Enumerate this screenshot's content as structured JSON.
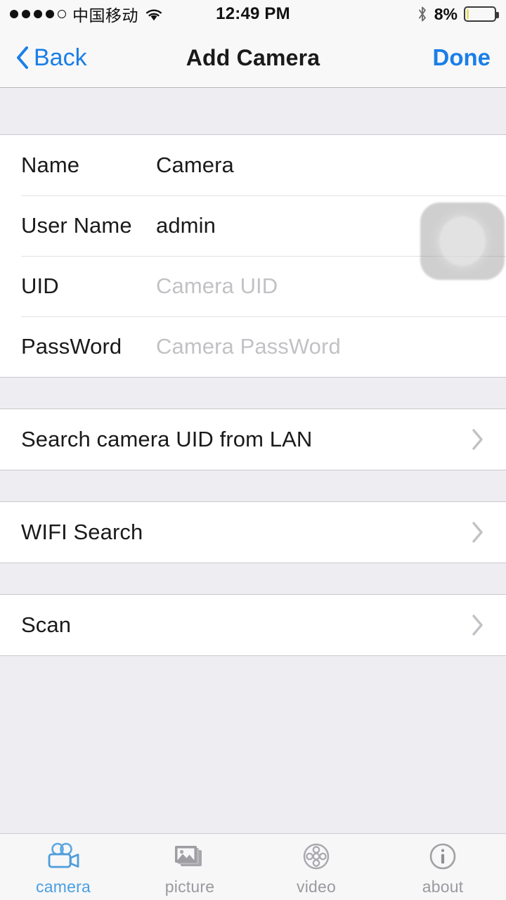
{
  "status_bar": {
    "signal_dots_filled": 4,
    "signal_dots_total": 5,
    "carrier": "中国移动",
    "wifi_icon": "wifi-icon",
    "time": "12:49 PM",
    "bluetooth_icon": "bluetooth-icon",
    "battery_percent": "8%",
    "battery_level": 8,
    "battery_color": "#e8dd6a"
  },
  "nav_bar": {
    "back_label": "Back",
    "back_icon": "chevron-left-icon",
    "title": "Add Camera",
    "done_label": "Done",
    "accent_color": "#1a7ee8"
  },
  "form": {
    "rows": [
      {
        "label": "Name",
        "value": "Camera",
        "is_placeholder": false
      },
      {
        "label": "User Name",
        "value": "admin",
        "is_placeholder": false
      },
      {
        "label": "UID",
        "value": "Camera UID",
        "is_placeholder": true
      },
      {
        "label": "PassWord",
        "value": "Camera PassWord",
        "is_placeholder": true
      }
    ]
  },
  "actions": [
    {
      "label": "Search camera UID from LAN",
      "chevron_icon": "chevron-right-icon"
    },
    {
      "label": "WIFI Search",
      "chevron_icon": "chevron-right-icon"
    },
    {
      "label": "Scan",
      "chevron_icon": "chevron-right-icon"
    }
  ],
  "assistive_touch": {
    "icon": "assistive-touch-icon"
  },
  "tab_bar": {
    "active_color": "#4a9fe0",
    "inactive_color": "#9a9a9f",
    "tabs": [
      {
        "label": "camera",
        "icon": "movie-camera-icon",
        "active": true
      },
      {
        "label": "picture",
        "icon": "photo-stack-icon",
        "active": false
      },
      {
        "label": "video",
        "icon": "film-reel-icon",
        "active": false
      },
      {
        "label": "about",
        "icon": "info-circle-icon",
        "active": false
      }
    ]
  }
}
